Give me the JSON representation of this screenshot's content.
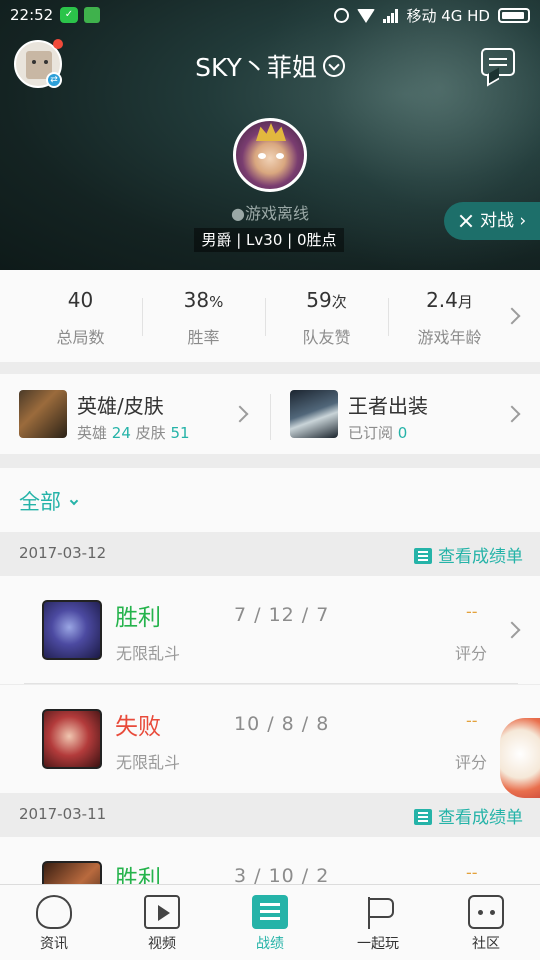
{
  "status_bar": {
    "time": "22:52",
    "carrier": "移动 4G HD"
  },
  "header": {
    "username": "SKY丶菲姐",
    "online_status": "●游戏离线",
    "info": "男爵 | Lv30 | 0胜点",
    "battle_button": "对战"
  },
  "stats": [
    {
      "value": "40",
      "unit": "",
      "label": "总局数"
    },
    {
      "value": "38",
      "unit": "%",
      "label": "胜率"
    },
    {
      "value": "59",
      "unit": "次",
      "label": "队友赞"
    },
    {
      "value": "2.4",
      "unit": "月",
      "label": "游戏年龄"
    }
  ],
  "heroes": {
    "title": "英雄/皮肤",
    "hero_label": "英雄",
    "hero_count": "24",
    "skin_label": "皮肤",
    "skin_count": "51"
  },
  "equipment": {
    "title": "王者出装",
    "sub_label": "已订阅",
    "sub_count": "0"
  },
  "filter": {
    "label": "全部"
  },
  "groups": [
    {
      "date": "2017-03-12",
      "link": "查看成绩单",
      "matches": [
        {
          "result": "胜利",
          "mode": "无限乱斗",
          "kda": "7 / 12 / 7",
          "score": "--",
          "score_label": "评分",
          "outcome": "win"
        },
        {
          "result": "失败",
          "mode": "无限乱斗",
          "kda": "10 / 8 / 8",
          "score": "--",
          "score_label": "评分",
          "outcome": "lose"
        }
      ]
    },
    {
      "date": "2017-03-11",
      "link": "查看成绩单",
      "matches": [
        {
          "result": "胜利",
          "mode": "",
          "kda": "3 / 10 / 2",
          "score": "--",
          "score_label": "",
          "outcome": "win"
        }
      ]
    }
  ],
  "bottom_nav": [
    {
      "label": "资讯",
      "icon": "news-icon"
    },
    {
      "label": "视频",
      "icon": "video-icon"
    },
    {
      "label": "战绩",
      "icon": "stats-icon",
      "active": true
    },
    {
      "label": "一起玩",
      "icon": "flag-icon"
    },
    {
      "label": "社区",
      "icon": "chat-icon"
    }
  ],
  "colors": {
    "accent": "#25b3a8",
    "win": "#25b34c",
    "lose": "#e84a3a",
    "score": "#e3a13b"
  }
}
